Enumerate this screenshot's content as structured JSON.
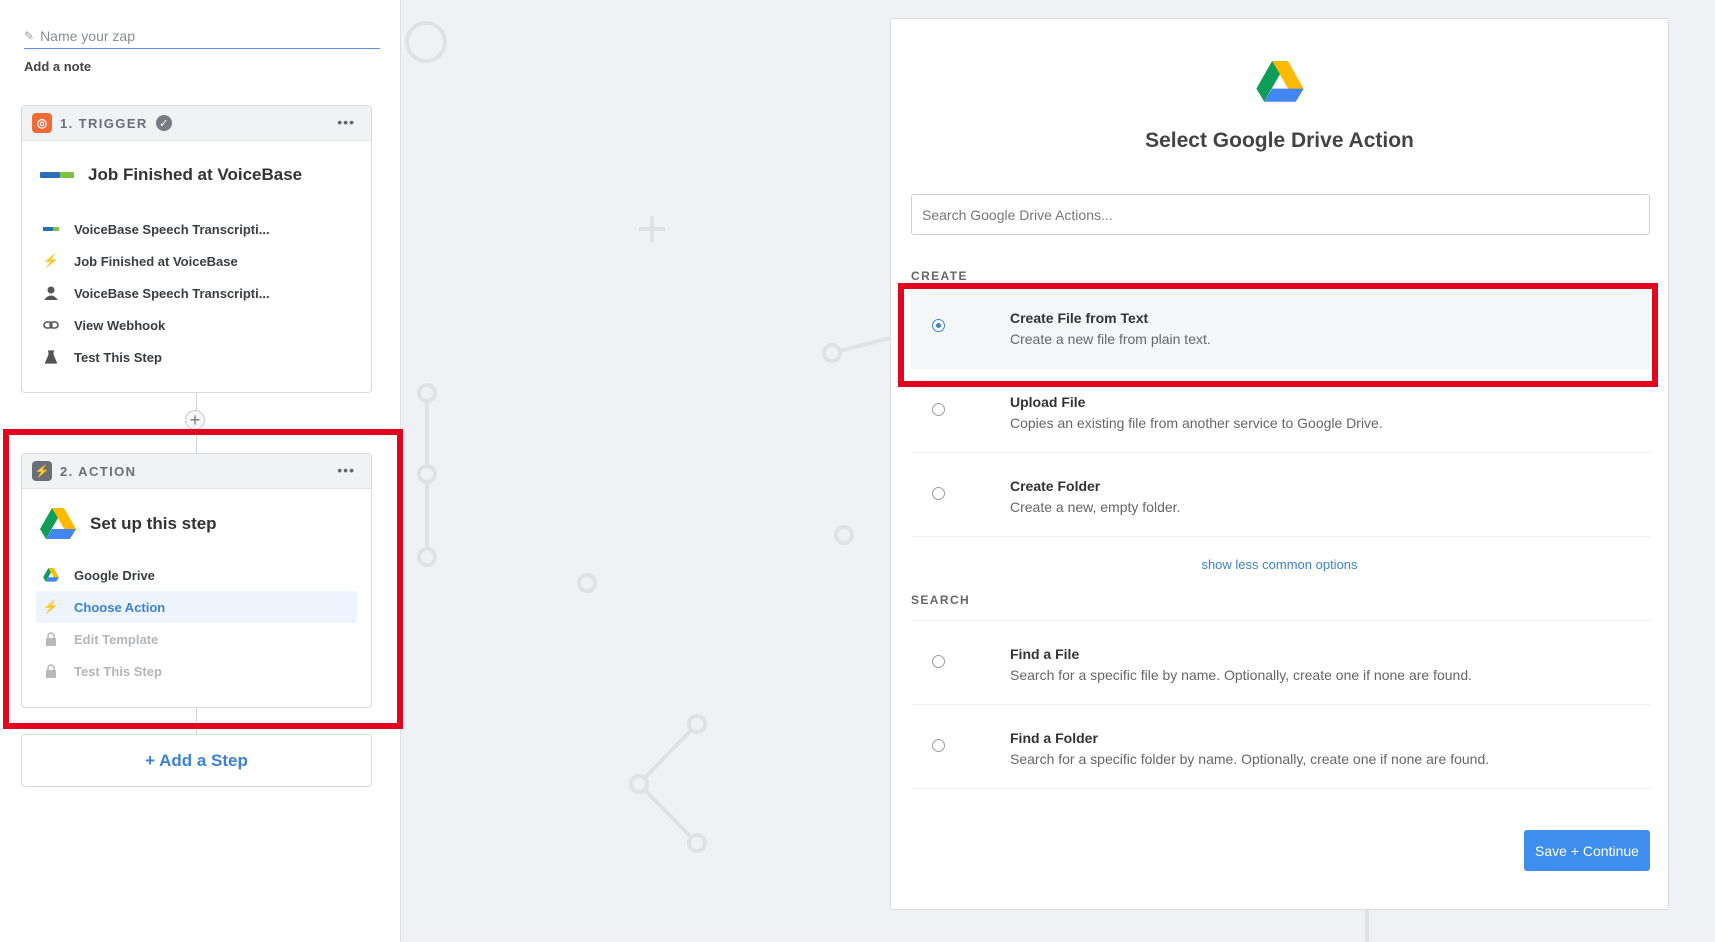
{
  "zap": {
    "name_placeholder": "Name your zap",
    "add_note": "Add a note"
  },
  "trigger": {
    "label": "1. TRIGGER",
    "title": "Job Finished at VoiceBase",
    "logo_text": "VoiceBase",
    "items": [
      {
        "label": "VoiceBase Speech Transcripti...",
        "icon": "voicebase-logo-icon"
      },
      {
        "label": "Job Finished at VoiceBase",
        "icon": "bolt-icon"
      },
      {
        "label": "VoiceBase Speech Transcripti...",
        "icon": "user-icon"
      },
      {
        "label": "View Webhook",
        "icon": "link-icon"
      },
      {
        "label": "Test This Step",
        "icon": "flask-icon"
      }
    ]
  },
  "action": {
    "label": "2. ACTION",
    "title": "Set up this step",
    "items": [
      {
        "label": "Google Drive",
        "icon": "google-drive-icon"
      },
      {
        "label": "Choose Action",
        "icon": "bolt-icon"
      },
      {
        "label": "Edit Template",
        "icon": "lock-icon"
      },
      {
        "label": "Test This Step",
        "icon": "lock-icon"
      }
    ]
  },
  "add_step": "+ Add a Step",
  "panel": {
    "title": "Select Google Drive Action",
    "search_placeholder": "Search Google Drive Actions...",
    "create_label": "CREATE",
    "search_label": "SEARCH",
    "show_less": "show less common options",
    "create_options": [
      {
        "title": "Create File from Text",
        "desc": "Create a new file from plain text.",
        "selected": true
      },
      {
        "title": "Upload File",
        "desc": "Copies an existing file from another service to Google Drive.",
        "selected": false
      },
      {
        "title": "Create Folder",
        "desc": "Create a new, empty folder.",
        "selected": false
      }
    ],
    "search_options": [
      {
        "title": "Find a File",
        "desc": "Search for a specific file by name. Optionally, create one if none are found.",
        "selected": false
      },
      {
        "title": "Find a Folder",
        "desc": "Search for a specific folder by name. Optionally, create one if none are found.",
        "selected": false
      }
    ],
    "save_label": "Save + Continue"
  },
  "colors": {
    "accent": "#3b82d6",
    "trigger_badge": "#f06a35",
    "action_badge": "#6b6e76",
    "highlight": "#e4051f"
  }
}
